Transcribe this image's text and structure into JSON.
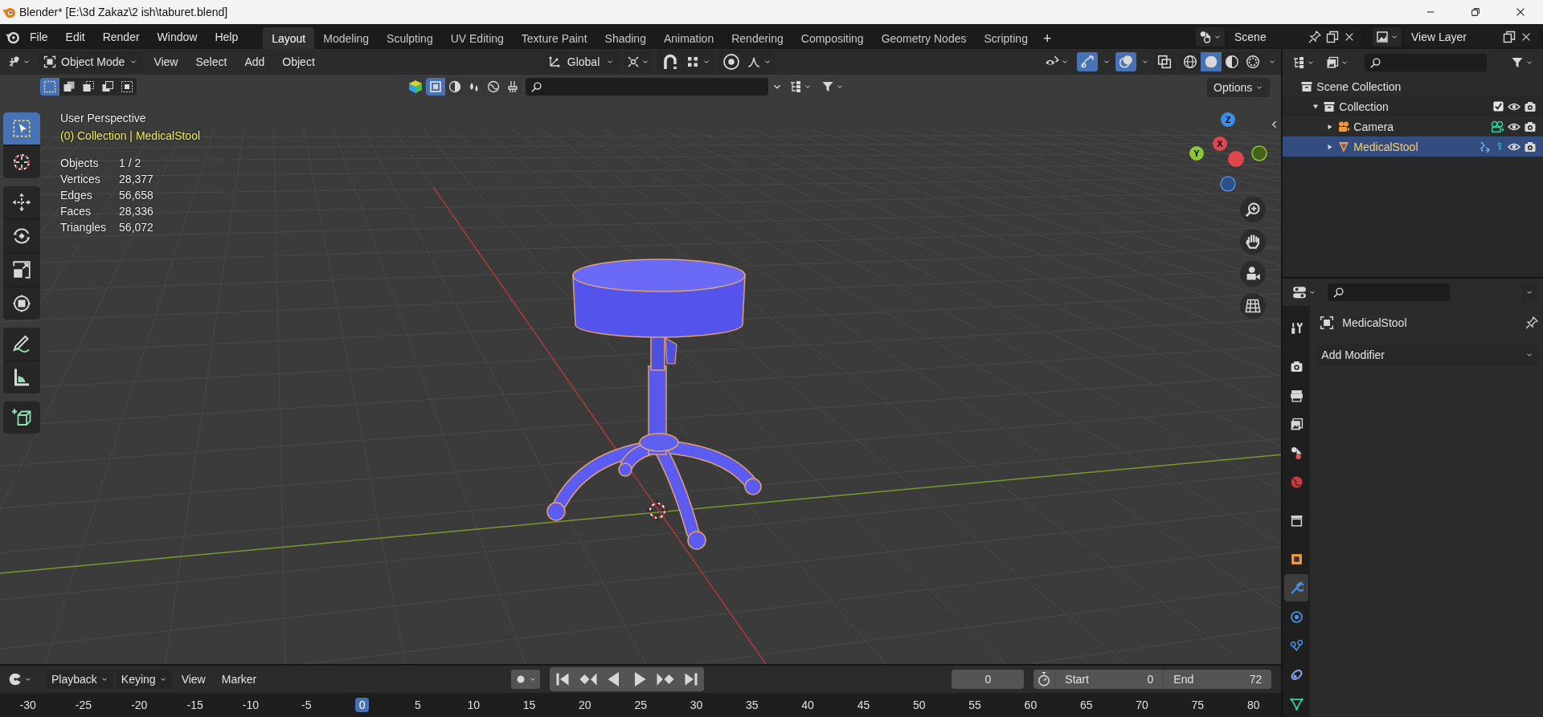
{
  "window": {
    "title": "Blender* [E:\\3d Zakaz\\2 ish\\taburet.blend]"
  },
  "menu": [
    "File",
    "Edit",
    "Render",
    "Window",
    "Help"
  ],
  "workspaces": [
    {
      "label": "Layout",
      "selected": true
    },
    {
      "label": "Modeling",
      "selected": false
    },
    {
      "label": "Sculpting",
      "selected": false
    },
    {
      "label": "UV Editing",
      "selected": false
    },
    {
      "label": "Texture Paint",
      "selected": false
    },
    {
      "label": "Shading",
      "selected": false
    },
    {
      "label": "Animation",
      "selected": false
    },
    {
      "label": "Rendering",
      "selected": false
    },
    {
      "label": "Compositing",
      "selected": false
    },
    {
      "label": "Geometry Nodes",
      "selected": false
    },
    {
      "label": "Scripting",
      "selected": false
    }
  ],
  "add_workspace": "+",
  "scene": "Scene",
  "view_layer": "View Layer",
  "viewport_header": {
    "mode": "Object Mode",
    "menus": [
      "View",
      "Select",
      "Add",
      "Object"
    ],
    "orientation": "Global",
    "toggles": [
      {
        "kind": "gizmo",
        "on": true
      },
      {
        "kind": "overlay",
        "on": true
      },
      {
        "kind": "xray",
        "on": false
      }
    ],
    "shading": [
      {
        "kind": "wireframe",
        "selected": false
      },
      {
        "kind": "solid",
        "selected": true
      },
      {
        "kind": "material",
        "selected": false
      },
      {
        "kind": "rendered",
        "selected": false
      }
    ],
    "select_modes": [
      {
        "kind": "new",
        "selected": true
      },
      {
        "kind": "extend",
        "selected": false
      },
      {
        "kind": "subtract",
        "selected": false
      },
      {
        "kind": "invert",
        "selected": false
      },
      {
        "kind": "intersect",
        "selected": false
      }
    ],
    "options": "Options"
  },
  "tool_groups": [
    [
      {
        "kind": "select_box",
        "selected": true
      },
      {
        "kind": "cursor",
        "selected": false
      }
    ],
    [
      {
        "kind": "move",
        "selected": false
      },
      {
        "kind": "rotate",
        "selected": false
      },
      {
        "kind": "scale",
        "selected": false
      },
      {
        "kind": "transform",
        "selected": false
      }
    ],
    [
      {
        "kind": "annotate",
        "selected": false
      },
      {
        "kind": "measure",
        "selected": false
      }
    ],
    [
      {
        "kind": "add_cube",
        "selected": false
      }
    ]
  ],
  "overlay": {
    "title": "User Perspective",
    "context": "(0) Collection | MedicalStool",
    "stats": [
      {
        "label": "Objects",
        "value": "1 / 2"
      },
      {
        "label": "Vertices",
        "value": "28,377"
      },
      {
        "label": "Edges",
        "value": "56,658"
      },
      {
        "label": "Faces",
        "value": "28,336"
      },
      {
        "label": "Triangles",
        "value": "56,072"
      }
    ]
  },
  "gizmo": {
    "axes": [
      "Z",
      "Y",
      "X"
    ]
  },
  "outliner": {
    "root": "Scene Collection",
    "items": [
      {
        "label": "Collection",
        "kind": "collection",
        "expanded": true,
        "checked": true,
        "selected": false,
        "children": [
          {
            "label": "Camera",
            "kind": "camera",
            "expanded": false,
            "selected": false
          },
          {
            "label": "MedicalStool",
            "kind": "mesh",
            "expanded": false,
            "selected": true
          }
        ]
      }
    ]
  },
  "properties": {
    "object": "MedicalStool",
    "add_modifier": "Add Modifier",
    "tab_groups": [
      [
        {
          "kind": "tool",
          "selected": false
        }
      ],
      [
        {
          "kind": "render",
          "selected": false
        },
        {
          "kind": "output",
          "selected": false
        },
        {
          "kind": "view_layer",
          "selected": false
        },
        {
          "kind": "scene",
          "selected": false
        },
        {
          "kind": "world",
          "selected": false
        }
      ],
      [
        {
          "kind": "collection",
          "selected": false
        }
      ],
      [
        {
          "kind": "object",
          "selected": false
        },
        {
          "kind": "modifiers",
          "selected": true
        },
        {
          "kind": "particles",
          "selected": false
        },
        {
          "kind": "physics",
          "selected": false
        },
        {
          "kind": "constraints",
          "selected": false
        },
        {
          "kind": "data",
          "selected": false
        }
      ]
    ]
  },
  "timeline": {
    "menus": [
      "Playback",
      "Keying",
      "View",
      "Marker"
    ],
    "current_frame": "0",
    "start_label": "Start",
    "start": "0",
    "end_label": "End",
    "end": "72",
    "ticks": [
      {
        "label": "-30",
        "selected": false
      },
      {
        "label": "-25",
        "selected": false
      },
      {
        "label": "-20",
        "selected": false
      },
      {
        "label": "-15",
        "selected": false
      },
      {
        "label": "-10",
        "selected": false
      },
      {
        "label": "-5",
        "selected": false
      },
      {
        "label": "0",
        "selected": true
      },
      {
        "label": "5",
        "selected": false
      },
      {
        "label": "10",
        "selected": false
      },
      {
        "label": "15",
        "selected": false
      },
      {
        "label": "20",
        "selected": false
      },
      {
        "label": "25",
        "selected": false
      },
      {
        "label": "30",
        "selected": false
      },
      {
        "label": "35",
        "selected": false
      },
      {
        "label": "40",
        "selected": false
      },
      {
        "label": "45",
        "selected": false
      },
      {
        "label": "50",
        "selected": false
      },
      {
        "label": "55",
        "selected": false
      },
      {
        "label": "60",
        "selected": false
      },
      {
        "label": "65",
        "selected": false
      },
      {
        "label": "70",
        "selected": false
      },
      {
        "label": "75",
        "selected": false
      },
      {
        "label": "80",
        "selected": false
      }
    ]
  }
}
